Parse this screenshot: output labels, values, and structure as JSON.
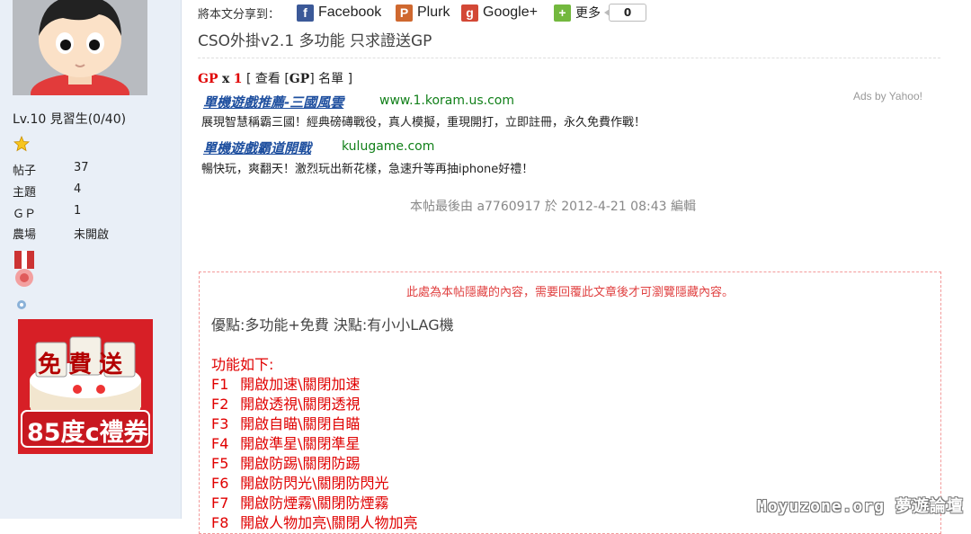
{
  "sidebar": {
    "level": "Lv.10 見習生(0/40)",
    "stats": [
      {
        "label": "帖子",
        "value": "37"
      },
      {
        "label": "主題",
        "value": "4"
      },
      {
        "label": "ＧＰ",
        "value": "1"
      },
      {
        "label": "農場",
        "value": "未開啟"
      }
    ],
    "ad": {
      "top_text": "免費送",
      "bottom_text": "85度c禮券"
    }
  },
  "share": {
    "prefix": "將本文分享到：",
    "items": [
      {
        "label": "Facebook",
        "icon": "facebook-icon",
        "color": "#3b5998",
        "glyph": "f"
      },
      {
        "label": "Plurk",
        "icon": "plurk-icon",
        "color": "#cf682f",
        "glyph": "P"
      },
      {
        "label": "Google+",
        "icon": "google-plus-icon",
        "color": "#d34836",
        "glyph": "g"
      },
      {
        "label": "更多",
        "icon": "addthis-more-icon",
        "color": "#73b83e",
        "glyph": "+"
      }
    ],
    "count": "0"
  },
  "post": {
    "title": "CSO外掛v2.1 多功能 只求證送GP",
    "gp_label": "GP",
    "gp_x": "x",
    "gp_count": "1",
    "gp_view": "[ 查看 [GP] 名單 ]",
    "gp_view_pre": "[ 查看 [",
    "gp_view_gp": "GP",
    "gp_view_post": "] 名單 ]",
    "edit_note": "本帖最後由 a7760917 於 2012-4-21 08:43 編輯"
  },
  "ads": {
    "by": "Ads by Yahoo!",
    "items": [
      {
        "title": "單機遊戲推薦-三國風雲",
        "url": "www.1.koram.us.com",
        "desc": "展現智慧稱霸三國！經典磅礡戰役，真人模擬，重現開打，立即註冊，永久免費作戰！"
      },
      {
        "title": "單機遊戲霸道開戰",
        "url": "kulugame.com",
        "desc": "暢快玩，爽翻天！激烈玩出新花樣，急速升等再抽iphone好禮！"
      }
    ]
  },
  "hidden": {
    "notice": "此處為本帖隱藏的內容，需要回覆此文章後才可瀏覽隱藏內容。",
    "pros": "優點:多功能+免費 決點:有小小LAG機",
    "features_title": "功能如下:",
    "features": [
      {
        "key": "F1",
        "text": "開啟加速\\關閉加速"
      },
      {
        "key": "F2",
        "text": "開啟透視\\關閉透視"
      },
      {
        "key": "F3",
        "text": "開啟自瞄\\關閉自瞄"
      },
      {
        "key": "F4",
        "text": "開啟準星\\關閉準星"
      },
      {
        "key": "F5",
        "text": "開啟防踢\\關閉防踢"
      },
      {
        "key": "F6",
        "text": "開啟防閃光\\關閉防閃光"
      },
      {
        "key": "F7",
        "text": "開啟防煙霧\\關閉防煙霧"
      },
      {
        "key": "F8",
        "text": "開啟人物加亮\\關閉人物加亮"
      }
    ]
  },
  "watermark": "Moyuzone.org 夢遊論壇"
}
